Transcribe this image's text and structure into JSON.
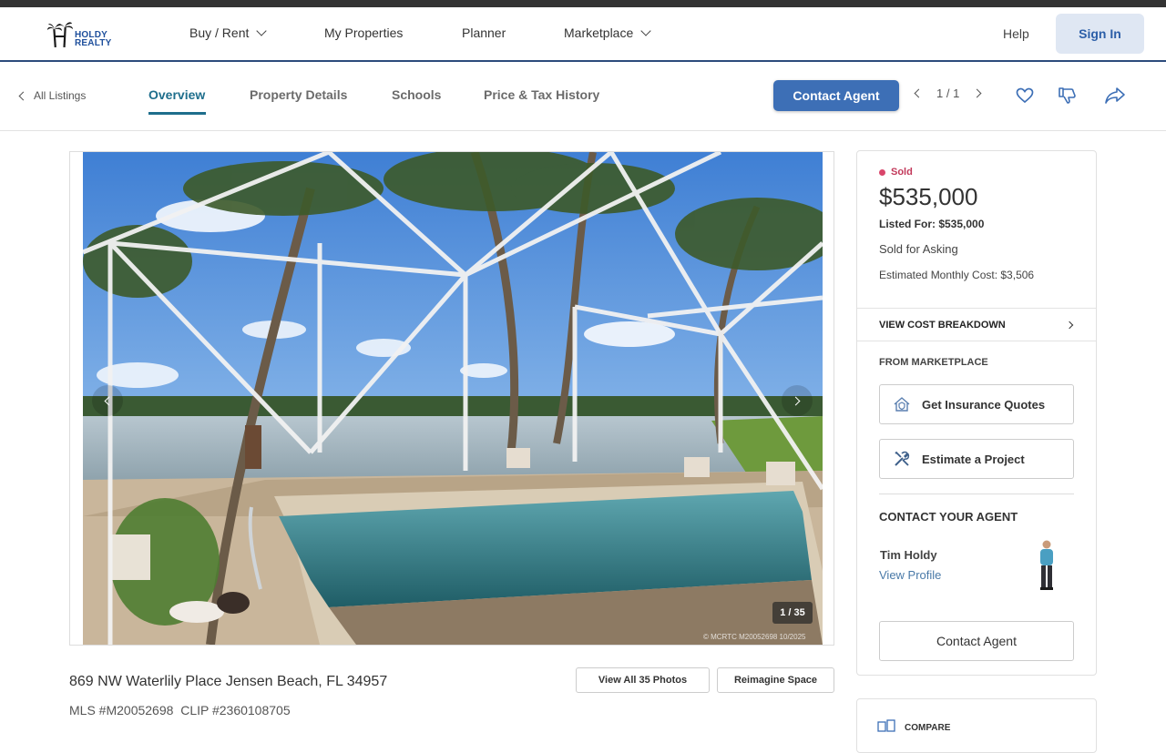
{
  "header": {
    "logo_text_line1": "HOLDY",
    "logo_text_line2": "REALTY",
    "nav": [
      {
        "label": "Buy / Rent",
        "has_dropdown": true
      },
      {
        "label": "My Properties",
        "has_dropdown": false
      },
      {
        "label": "Planner",
        "has_dropdown": false
      },
      {
        "label": "Marketplace",
        "has_dropdown": true
      }
    ],
    "help": "Help",
    "sign_in": "Sign In"
  },
  "subnav": {
    "back": "All Listings",
    "tabs": [
      {
        "label": "Overview",
        "active": true
      },
      {
        "label": "Property Details",
        "active": false
      },
      {
        "label": "Schools",
        "active": false
      },
      {
        "label": "Price & Tax History",
        "active": false
      }
    ],
    "contact_agent": "Contact Agent",
    "pager": "1 / 1",
    "icons": [
      "heart-icon",
      "thumbs-down-icon",
      "share-icon"
    ]
  },
  "gallery": {
    "counter": "1 / 35",
    "credit": "© MCRTC M20052698 10/2025"
  },
  "listing": {
    "address": "869 NW Waterlily Place Jensen Beach, FL 34957",
    "mls": "MLS #M20052698",
    "clip": "CLIP #2360108705",
    "view_all_photos": "View All 35 Photos",
    "reimagine": "Reimagine Space"
  },
  "sidebar": {
    "status": "Sold",
    "price": "$535,000",
    "listed_for": "Listed For: $535,000",
    "sold_note": "Sold for Asking",
    "monthly_cost": "Estimated Monthly Cost: $3,506",
    "cost_breakdown": "VIEW COST BREAKDOWN",
    "from_marketplace": "FROM MARKETPLACE",
    "insurance": "Get Insurance Quotes",
    "estimate": "Estimate a Project",
    "contact_title": "CONTACT YOUR AGENT",
    "agent_name": "Tim Holdy",
    "view_profile": "View Profile",
    "contact_button": "Contact Agent"
  },
  "compare_card": {
    "label": "COMPARE"
  },
  "colors": {
    "accent_blue": "#3d6fb6",
    "tab_active": "#1e6e8c",
    "sold_red": "#c2395a",
    "header_rule": "#2c4b7c"
  }
}
